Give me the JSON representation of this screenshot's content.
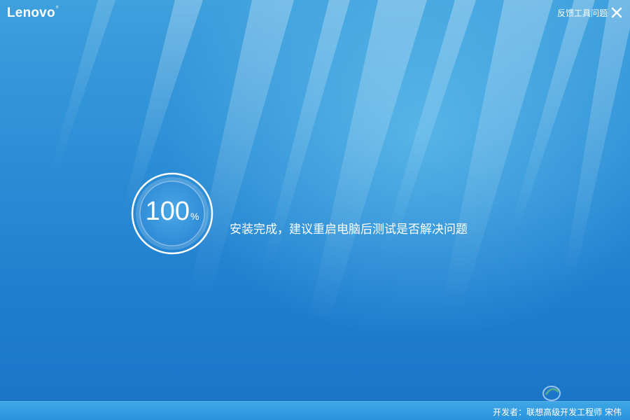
{
  "window": {
    "brand": "Lenovo",
    "feedback_label": "反馈工具问题",
    "close_icon": "close-icon"
  },
  "progress": {
    "value": "100",
    "unit": "%",
    "fraction": 1.0
  },
  "status": {
    "message": "安装完成，建议重启电脑后测试是否解决问题"
  },
  "footer": {
    "developer_credit": "开发者：联想高级开发工程师 宋伟"
  },
  "colors": {
    "background_top": "#3ea0dd",
    "background_bottom": "#1a74c9",
    "text": "#ffffff"
  }
}
